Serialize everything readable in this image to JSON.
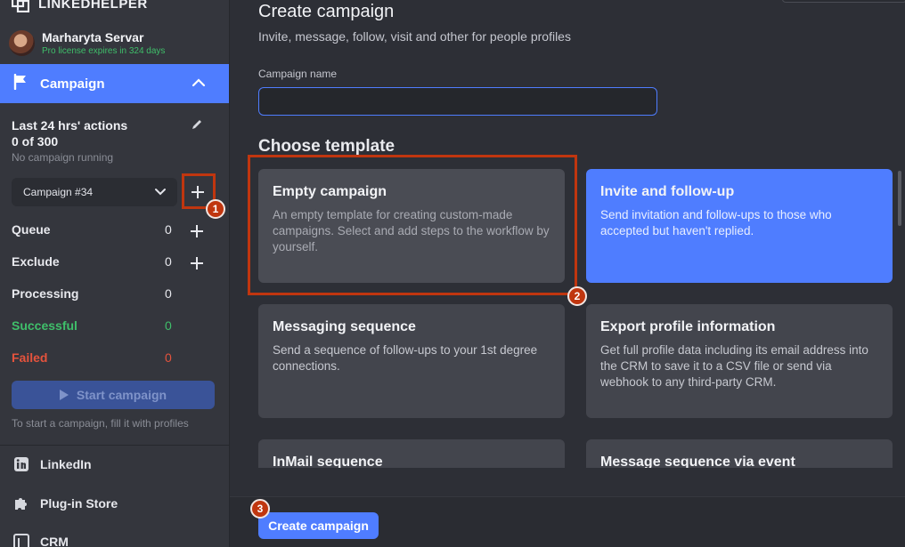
{
  "brand": {
    "name": "LINKEDHELPER",
    "mark": "™"
  },
  "user": {
    "name": "Marharyta Servar",
    "license": "Pro license expires in 324 days"
  },
  "sidebar": {
    "campaign_nav": {
      "label": "Campaign",
      "icon": "flag-icon",
      "expanded": true
    },
    "stats_title": "Last 24 hrs' actions",
    "stats_count": "0 of 300",
    "stats_status": "No campaign running",
    "campaign_select": {
      "value": "Campaign #34"
    },
    "stats": [
      {
        "label": "Queue",
        "value": "0",
        "has_add": true,
        "color": "#e8e9ee"
      },
      {
        "label": "Exclude",
        "value": "0",
        "has_add": true,
        "color": "#e8e9ee"
      },
      {
        "label": "Processing",
        "value": "0",
        "has_add": false,
        "color": "#e8e9ee"
      },
      {
        "label": "Successful",
        "value": "0",
        "has_add": false,
        "color": "#3fbf6a"
      },
      {
        "label": "Failed",
        "value": "0",
        "has_add": false,
        "color": "#e5533d"
      }
    ],
    "start_button": "Start campaign",
    "start_hint": "To start a campaign, fill it with profiles",
    "bottom_items": [
      {
        "label": "LinkedIn",
        "icon": "linkedin-icon"
      },
      {
        "label": "Plug-in Store",
        "icon": "puzzle-icon"
      },
      {
        "label": "CRM",
        "icon": "crm-icon"
      }
    ]
  },
  "main": {
    "title": "Create campaign",
    "subtitle": "Invite, message, follow, visit and other for people profiles",
    "name_field": {
      "label": "Campaign name",
      "value": "",
      "placeholder": ""
    },
    "section_title": "Choose template",
    "templates": [
      {
        "title": "Empty campaign",
        "desc": "An empty template for creating custom-made campaigns. Select and add steps to the workflow by yourself.",
        "state": "selected"
      },
      {
        "title": "Invite and follow-up",
        "desc": "Send invitation and follow-ups to those who accepted but haven't replied.",
        "state": "active"
      },
      {
        "title": "Messaging sequence",
        "desc": "Send a sequence of follow-ups to your 1st degree connections.",
        "state": "normal"
      },
      {
        "title": "Export profile information",
        "desc": "Get full profile data including its email address into the CRM to save it to a CSV file or send via webhook to any third-party CRM.",
        "state": "normal"
      },
      {
        "title": "InMail sequence",
        "desc": "",
        "state": "normal"
      },
      {
        "title": "Message sequence via event",
        "desc": "",
        "state": "normal"
      }
    ],
    "create_button": "Create campaign"
  },
  "annotations": [
    {
      "number": "1"
    },
    {
      "number": "2"
    },
    {
      "number": "3"
    }
  ],
  "colors": {
    "accent": "#4f7dff",
    "success": "#3fbf6a",
    "danger": "#e5533d",
    "highlight": "#c0360f"
  }
}
